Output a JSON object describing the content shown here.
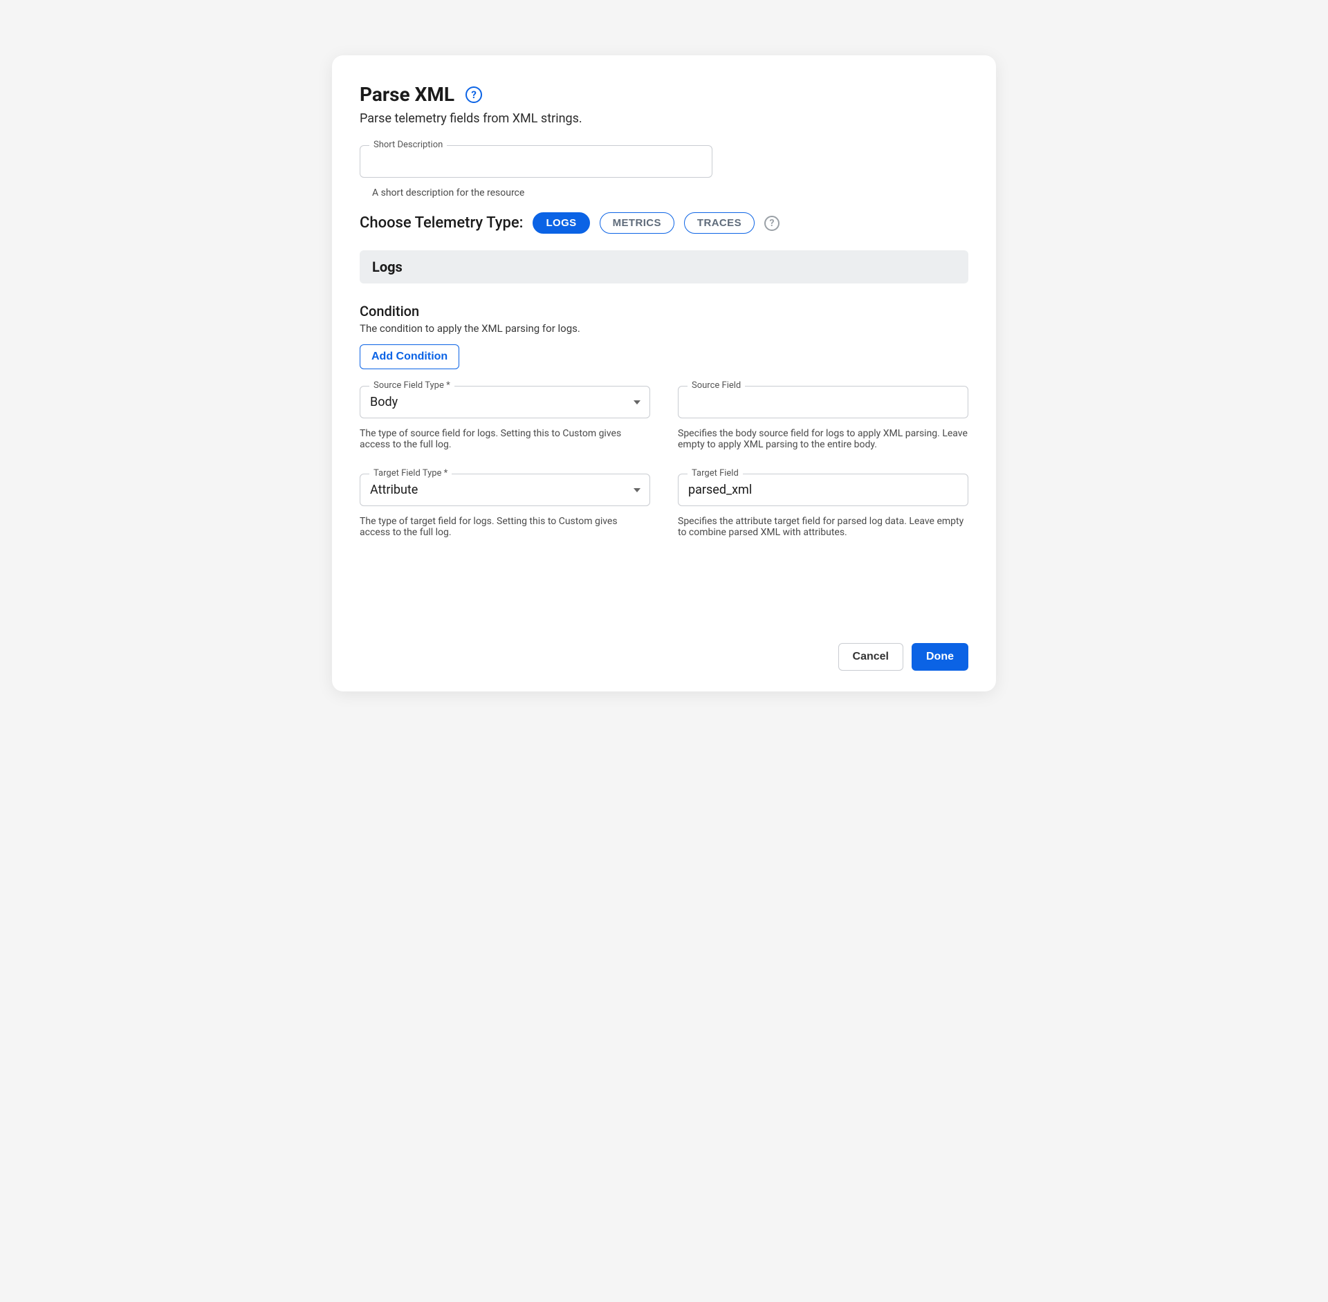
{
  "header": {
    "title": "Parse XML",
    "subtitle": "Parse telemetry fields from XML strings."
  },
  "short_description": {
    "label": "Short Description",
    "value": "",
    "helper": "A short description for the resource"
  },
  "telemetry": {
    "label": "Choose Telemetry Type:",
    "options": {
      "logs": "LOGS",
      "metrics": "METRICS",
      "traces": "TRACES"
    },
    "active": "logs"
  },
  "section": {
    "bar_title": "Logs",
    "condition": {
      "heading": "Condition",
      "sub": "The condition to apply the XML parsing for logs.",
      "add_button": "Add Condition"
    },
    "source_field_type": {
      "label": "Source Field Type *",
      "value": "Body",
      "helper": "The type of source field for logs. Setting this to Custom gives access to the full log."
    },
    "source_field": {
      "label": "Source Field",
      "value": "",
      "helper": "Specifies the body source field for logs to apply XML parsing. Leave empty to apply XML parsing to the entire body."
    },
    "target_field_type": {
      "label": "Target Field Type *",
      "value": "Attribute",
      "helper": "The type of target field for logs. Setting this to Custom gives access to the full log."
    },
    "target_field": {
      "label": "Target Field",
      "value": "parsed_xml",
      "helper": "Specifies the attribute target field for parsed log data. Leave empty to combine parsed XML with attributes."
    }
  },
  "footer": {
    "cancel": "Cancel",
    "done": "Done"
  }
}
